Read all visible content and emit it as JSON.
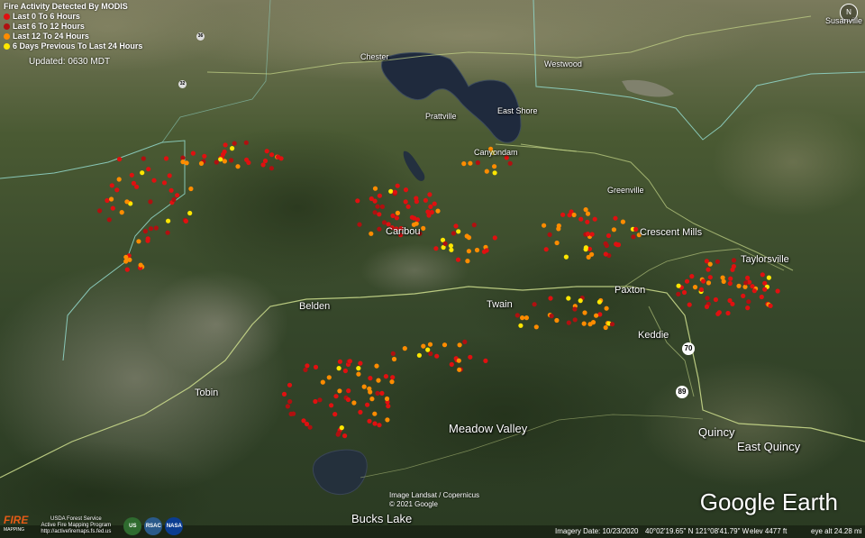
{
  "legend": {
    "title": "Fire Activity Detected By MODIS",
    "items": [
      {
        "label": "Last 0 To 6 Hours",
        "color": "#e01010"
      },
      {
        "label": "Last 6 To 12 Hours",
        "color": "#b01010"
      },
      {
        "label": "Last 12 To 24 Hours",
        "color": "#ff8c00"
      },
      {
        "label": "6 Days Previous To Last 24 Hours",
        "color": "#ffe600"
      }
    ],
    "updated": "Updated: 0630 MDT"
  },
  "places": {
    "susanville": "Susanville",
    "chester": "Chester",
    "westwood": "Westwood",
    "prattville": "Prattville",
    "east_shore": "East Shore",
    "canyondam": "Canyondam",
    "greenville": "Greenville",
    "caribou": "Caribou",
    "crescent_mills": "Crescent Mills",
    "taylorsville": "Taylorsville",
    "belden": "Belden",
    "twain": "Twain",
    "paxton": "Paxton",
    "keddie": "Keddie",
    "tobin": "Tobin",
    "meadow_valley": "Meadow Valley",
    "quincy": "Quincy",
    "east_quincy": "East Quincy",
    "bucks_lake": "Bucks Lake"
  },
  "highways": {
    "hwy_36": "36",
    "hwy_32": "32",
    "hwy_70": "70",
    "hwy_89": "89"
  },
  "branding": {
    "google_earth": "Google Earth",
    "image_credit": "Image Landsat / Copernicus",
    "copyright": "© 2021 Google",
    "fire_logo": "FIRE",
    "fire_logo_sub": "MAPPING",
    "usda_line1": "USDA Forest Service",
    "usda_line2": "Active Fire Mapping Program",
    "usda_line3": "http://activefiremaps.fs.fed.us",
    "rsac_badge": "RSAC",
    "nasa_badge": "NASA",
    "usfs_badge": "US"
  },
  "status_bar": {
    "imagery_date": "Imagery Date: 10/23/2020",
    "coordinates": "40°02'19.65\" N  121°08'41.79\" W",
    "elevation": "elev  4477 ft",
    "eye_alt": "eye alt  24.28 mi"
  },
  "compass_label": "N"
}
